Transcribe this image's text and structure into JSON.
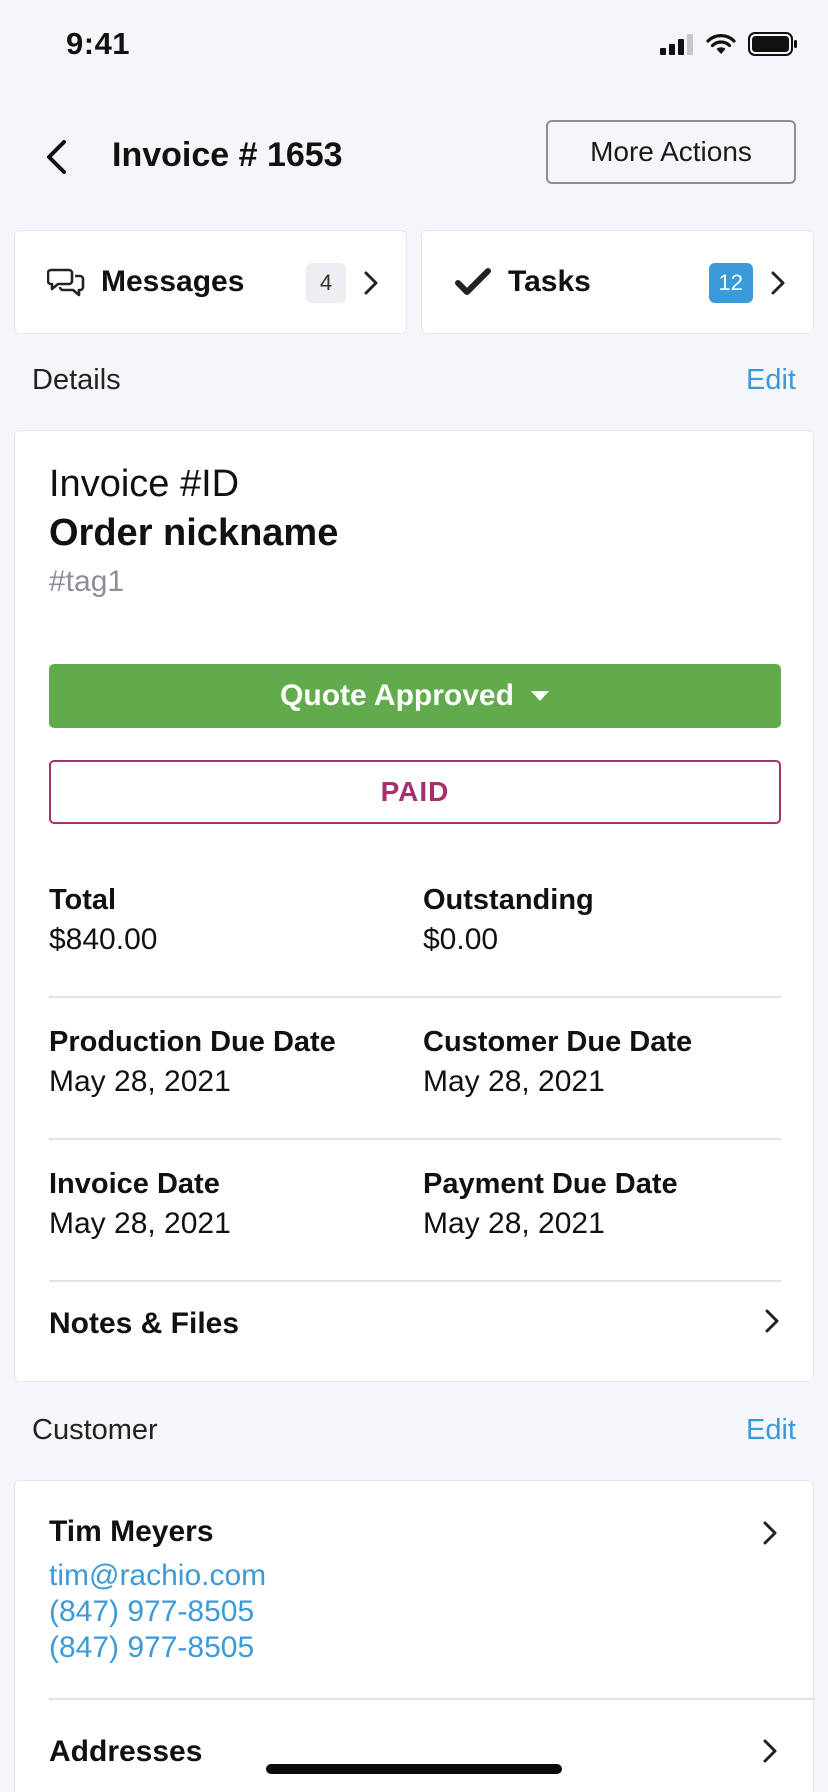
{
  "status_bar": {
    "time": "9:41"
  },
  "header": {
    "title": "Invoice # 1653",
    "more_actions_label": "More Actions"
  },
  "quick_links": {
    "messages": {
      "label": "Messages",
      "count": "4"
    },
    "tasks": {
      "label": "Tasks",
      "count": "12"
    }
  },
  "details_section": {
    "heading": "Details",
    "edit_label": "Edit",
    "invoice_id": "Invoice #ID",
    "order_nickname": "Order nickname",
    "tag": "#tag1",
    "status_label": "Quote Approved",
    "payment_status": "PAID",
    "fields": [
      {
        "label": "Total",
        "value": "$840.00"
      },
      {
        "label": "Outstanding",
        "value": "$0.00"
      },
      {
        "label": "Production Due Date",
        "value": "May 28, 2021"
      },
      {
        "label": "Customer Due Date",
        "value": "May 28, 2021"
      },
      {
        "label": "Invoice Date",
        "value": "May 28, 2021"
      },
      {
        "label": "Payment Due Date",
        "value": "May 28, 2021"
      }
    ],
    "notes_label": "Notes & Files"
  },
  "customer_section": {
    "heading": "Customer",
    "edit_label": "Edit",
    "name": "Tim Meyers",
    "email": "tim@rachio.com",
    "phones": [
      "(847) 977-8505",
      "(847) 977-8505"
    ],
    "addresses_label": "Addresses"
  },
  "colors": {
    "accent_blue": "#3b9ad9",
    "status_green": "#62ab4d",
    "paid_magenta": "#a3306f",
    "background": "#f4f6fa"
  },
  "icons": [
    "signal-icon",
    "wifi-icon",
    "battery-icon",
    "back-chevron-icon",
    "chat-bubbles-icon",
    "checkmark-icon",
    "chevron-right-icon",
    "caret-down-icon"
  ]
}
